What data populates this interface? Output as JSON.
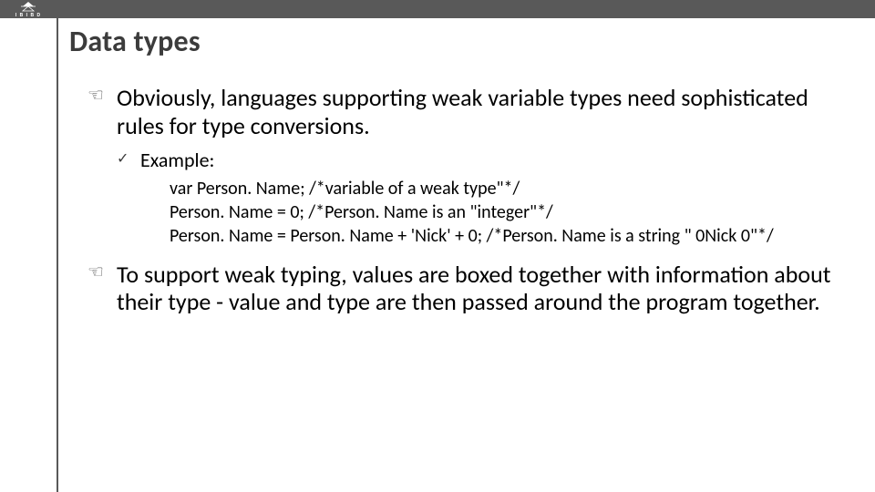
{
  "slide": {
    "title": "Data types",
    "logo_text": "I B I B D",
    "bullets": [
      {
        "level": 1,
        "text": "Obviously, languages supporting weak variable types need sophisticated rules for type conversions."
      },
      {
        "level": 2,
        "text": "Example:"
      }
    ],
    "code_lines": [
      "var Person. Name; /*variable of a weak type\"*/",
      "Person. Name = 0; /*Person. Name is an \"integer\"*/",
      "Person. Name = Person. Name + 'Nick' + 0; /*Person. Name is a string \" 0Nick 0\"*/"
    ],
    "bullets2": [
      {
        "level": 1,
        "text": "To support weak typing, values are boxed together with information about their type - value and type are then passed around the program together."
      }
    ]
  }
}
